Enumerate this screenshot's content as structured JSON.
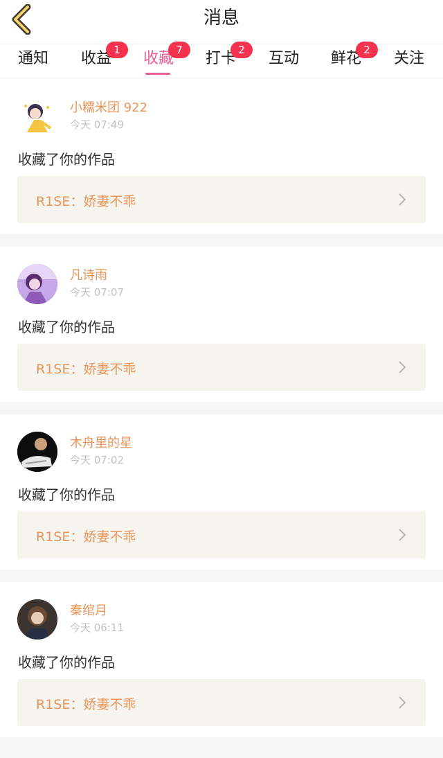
{
  "header": {
    "title": "消息"
  },
  "tabs": [
    {
      "label": "通知",
      "badge": null,
      "active": false
    },
    {
      "label": "收益",
      "badge": "1",
      "active": false
    },
    {
      "label": "收藏",
      "badge": "7",
      "active": true
    },
    {
      "label": "打卡",
      "badge": "2",
      "active": false
    },
    {
      "label": "互动",
      "badge": null,
      "active": false
    },
    {
      "label": "鲜花",
      "badge": "2",
      "active": false
    },
    {
      "label": "关注",
      "badge": null,
      "active": false
    }
  ],
  "notifications": [
    {
      "user": "小糯米团 922",
      "time": "今天 07:49",
      "action": "收藏了你的作品",
      "work": "R1SE：娇妻不乖"
    },
    {
      "user": "凡诗雨",
      "time": "今天 07:07",
      "action": "收藏了你的作品",
      "work": "R1SE：娇妻不乖"
    },
    {
      "user": "木舟里的星",
      "time": "今天 07:02",
      "action": "收藏了你的作品",
      "work": "R1SE：娇妻不乖"
    },
    {
      "user": "秦绾月",
      "time": "今天 06:11",
      "action": "收藏了你的作品",
      "work": "R1SE：娇妻不乖"
    }
  ],
  "colors": {
    "accent": "#ec5e97",
    "badge": "#f5334f",
    "name": "#e8955b"
  }
}
